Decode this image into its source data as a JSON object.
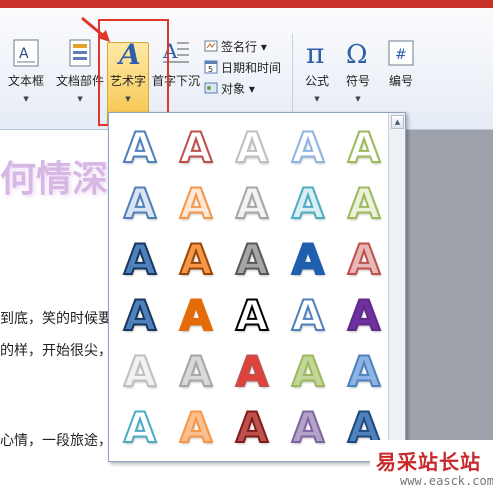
{
  "ribbon": {
    "buttons": [
      {
        "label": "文本框"
      },
      {
        "label": "文档部件"
      },
      {
        "label": "艺术字"
      },
      {
        "label": "首字下沉"
      }
    ],
    "small_buttons": [
      {
        "label": "签名行 ▾"
      },
      {
        "label": "日期和时间"
      },
      {
        "label": "对象 ▾"
      }
    ],
    "symbols": [
      {
        "label": "公式"
      },
      {
        "label": "符号"
      },
      {
        "label": "编号"
      }
    ]
  },
  "document": {
    "heading_fragment": "何情深",
    "lines": [
      "到底，笑的时候要",
      "的样，开始很尖，",
      "心情，一段旅途，"
    ]
  },
  "gallery": {
    "glyph": "A",
    "styles": [
      {
        "fill": "#ffffff",
        "stroke": "#4f81bd"
      },
      {
        "fill": "#ffffff",
        "stroke": "#c0504d"
      },
      {
        "fill": "#ffffff",
        "stroke": "#bfbfbf"
      },
      {
        "fill": "#ffffff",
        "stroke": "#8eb4e3"
      },
      {
        "fill": "#ffffff",
        "stroke": "#9bbb59"
      },
      {
        "fill": "#dbe5f1",
        "stroke": "#4f81bd"
      },
      {
        "fill": "#fde9d9",
        "stroke": "#f79646"
      },
      {
        "fill": "#f2f2f2",
        "stroke": "#a6a6a6"
      },
      {
        "fill": "#daeef3",
        "stroke": "#4bacc6"
      },
      {
        "fill": "#ebf1dd",
        "stroke": "#9bbb59"
      },
      {
        "fill": "#4f81bd",
        "stroke": "#17375e"
      },
      {
        "fill": "#f79646",
        "stroke": "#974806"
      },
      {
        "fill": "#a6a6a6",
        "stroke": "#595959"
      },
      {
        "fill": "#1f5fad",
        "stroke": "#1f5fad"
      },
      {
        "fill": "#e6b9b8",
        "stroke": "#c0504d"
      },
      {
        "fill": "#4f81bd",
        "stroke": "#17375e"
      },
      {
        "fill": "#e36c09",
        "stroke": "#e36c09"
      },
      {
        "fill": "#ffffff",
        "stroke": "#000000"
      },
      {
        "fill": "#ffffff",
        "stroke": "#4f81bd"
      },
      {
        "fill": "#7030a0",
        "stroke": "#5f2a8a"
      },
      {
        "fill": "#f2f2f2",
        "stroke": "#bfbfbf"
      },
      {
        "fill": "#d9d9d9",
        "stroke": "#a6a6a6"
      },
      {
        "fill": "#e3403a",
        "stroke": "#c0504d"
      },
      {
        "fill": "#c3d69b",
        "stroke": "#9bbb59"
      },
      {
        "fill": "#8eb4e3",
        "stroke": "#4f81bd"
      },
      {
        "fill": "#ffffff",
        "stroke": "#4bacc6"
      },
      {
        "fill": "#fac08f",
        "stroke": "#f79646"
      },
      {
        "fill": "#c0504d",
        "stroke": "#7f1d1b"
      },
      {
        "fill": "#b3a2c7",
        "stroke": "#8064a2"
      },
      {
        "fill": "#4f81bd",
        "stroke": "#1f497d"
      }
    ]
  },
  "watermark": {
    "name": "易采站长站",
    "url": "www.easck.com"
  }
}
